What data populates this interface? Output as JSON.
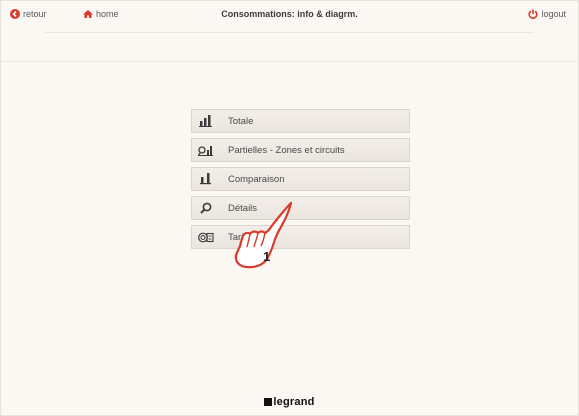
{
  "topbar": {
    "back_label": "retour",
    "home_label": "home",
    "title": "Consommations: info & diagrm.",
    "logout_label": "logout"
  },
  "colors": {
    "accent_red": "#d93a2b",
    "background": "#fbf7f3",
    "menu_item_bg": "#efe9e3"
  },
  "menu": {
    "items": [
      {
        "label": "Totale",
        "icon": "bar-chart-icon"
      },
      {
        "label": "Partielles - Zones et circuits",
        "icon": "partial-chart-icon"
      },
      {
        "label": "Comparaison",
        "icon": "comparison-icon"
      },
      {
        "label": "Détails",
        "icon": "magnifier-icon"
      },
      {
        "label": "Tarifs",
        "icon": "tariff-icon"
      }
    ]
  },
  "annotation": {
    "callout_number": "1"
  },
  "footer": {
    "brand": "legrand"
  }
}
